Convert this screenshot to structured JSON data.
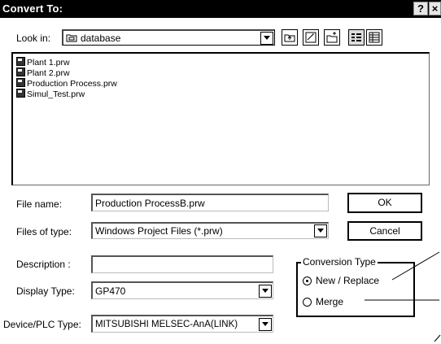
{
  "dialog": {
    "title": "Convert To:",
    "help_label": "?",
    "close_label": "×"
  },
  "look_in": {
    "label": "Look in:",
    "value": "database"
  },
  "files": [
    "Plant 1.prw",
    "Plant 2.prw",
    "Production Process.prw",
    "Simul_Test.prw"
  ],
  "file_name": {
    "label": "File name:",
    "value": "Production ProcessB.prw"
  },
  "files_of_type": {
    "label": "Files of type:",
    "value": "Windows Project Files (*.prw)"
  },
  "description": {
    "label": "Description :",
    "value": ""
  },
  "display_type": {
    "label": "Display Type:",
    "value": "GP470"
  },
  "device_plc_type": {
    "label": "Device/PLC Type:",
    "value": "MITSUBISHI MELSEC-AnA(LINK)"
  },
  "buttons": {
    "ok": "OK",
    "cancel": "Cancel"
  },
  "conversion_type": {
    "label": "Conversion Type",
    "options": [
      "New / Replace",
      "Merge"
    ],
    "selected": "New / Replace"
  }
}
